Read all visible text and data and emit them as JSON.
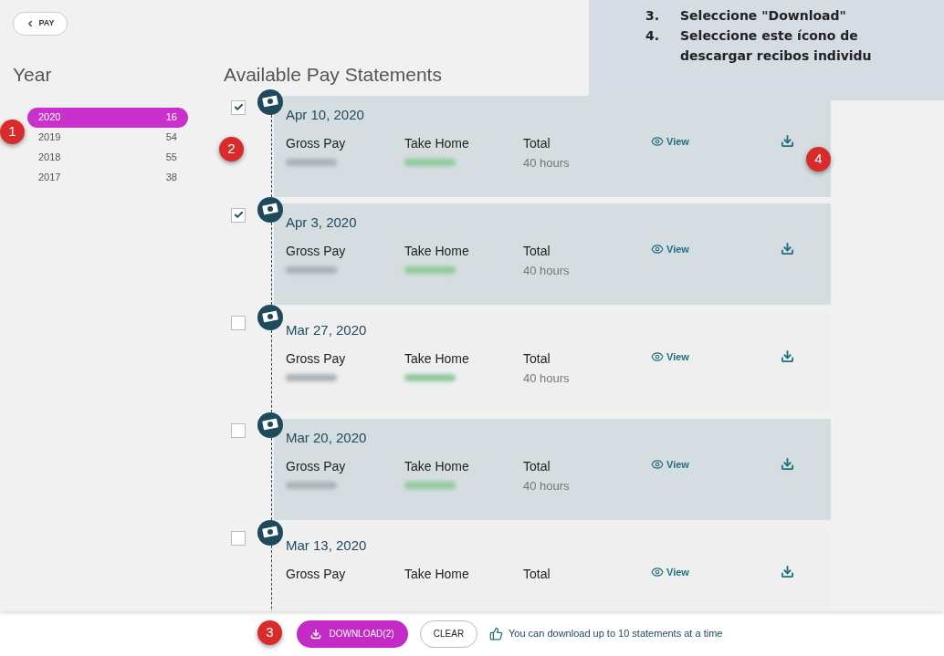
{
  "back_button": {
    "label": "PAY"
  },
  "instructions": [
    {
      "number": "3.",
      "text": "Seleccione \"Download\""
    },
    {
      "number": "4.",
      "text": "Seleccione este ícono de descargar recibos individu"
    }
  ],
  "year_panel": {
    "title": "Year",
    "years": [
      {
        "year": "2020",
        "count": "16",
        "selected": true
      },
      {
        "year": "2019",
        "count": "54",
        "selected": false
      },
      {
        "year": "2018",
        "count": "55",
        "selected": false
      },
      {
        "year": "2017",
        "count": "38",
        "selected": false
      }
    ]
  },
  "statements": {
    "title": "Available Pay Statements",
    "rows": [
      {
        "date": "Apr 10, 2020",
        "checked": true,
        "shaded": true,
        "gross_label": "Gross Pay",
        "take_home_label": "Take Home",
        "total_label": "Total",
        "total": "40 hours",
        "view": "View"
      },
      {
        "date": "Apr 3, 2020",
        "checked": true,
        "shaded": true,
        "gross_label": "Gross Pay",
        "take_home_label": "Take Home",
        "total_label": "Total",
        "total": "40 hours",
        "view": "View"
      },
      {
        "date": "Mar 27, 2020",
        "checked": false,
        "shaded": false,
        "gross_label": "Gross Pay",
        "take_home_label": "Take Home",
        "total_label": "Total",
        "total": "40 hours",
        "view": "View"
      },
      {
        "date": "Mar 20, 2020",
        "checked": false,
        "shaded": true,
        "gross_label": "Gross Pay",
        "take_home_label": "Take Home",
        "total_label": "Total",
        "total": "40 hours",
        "view": "View"
      },
      {
        "date": "Mar 13, 2020",
        "checked": false,
        "shaded": false,
        "gross_label": "Gross Pay",
        "take_home_label": "Take Home",
        "total_label": "Total",
        "view": "View"
      }
    ]
  },
  "footer": {
    "download": "DOWNLOAD(2)",
    "clear": "CLEAR",
    "hint": "You can download up to 10 statements at a time"
  },
  "markers": [
    "1",
    "2",
    "3",
    "4"
  ]
}
